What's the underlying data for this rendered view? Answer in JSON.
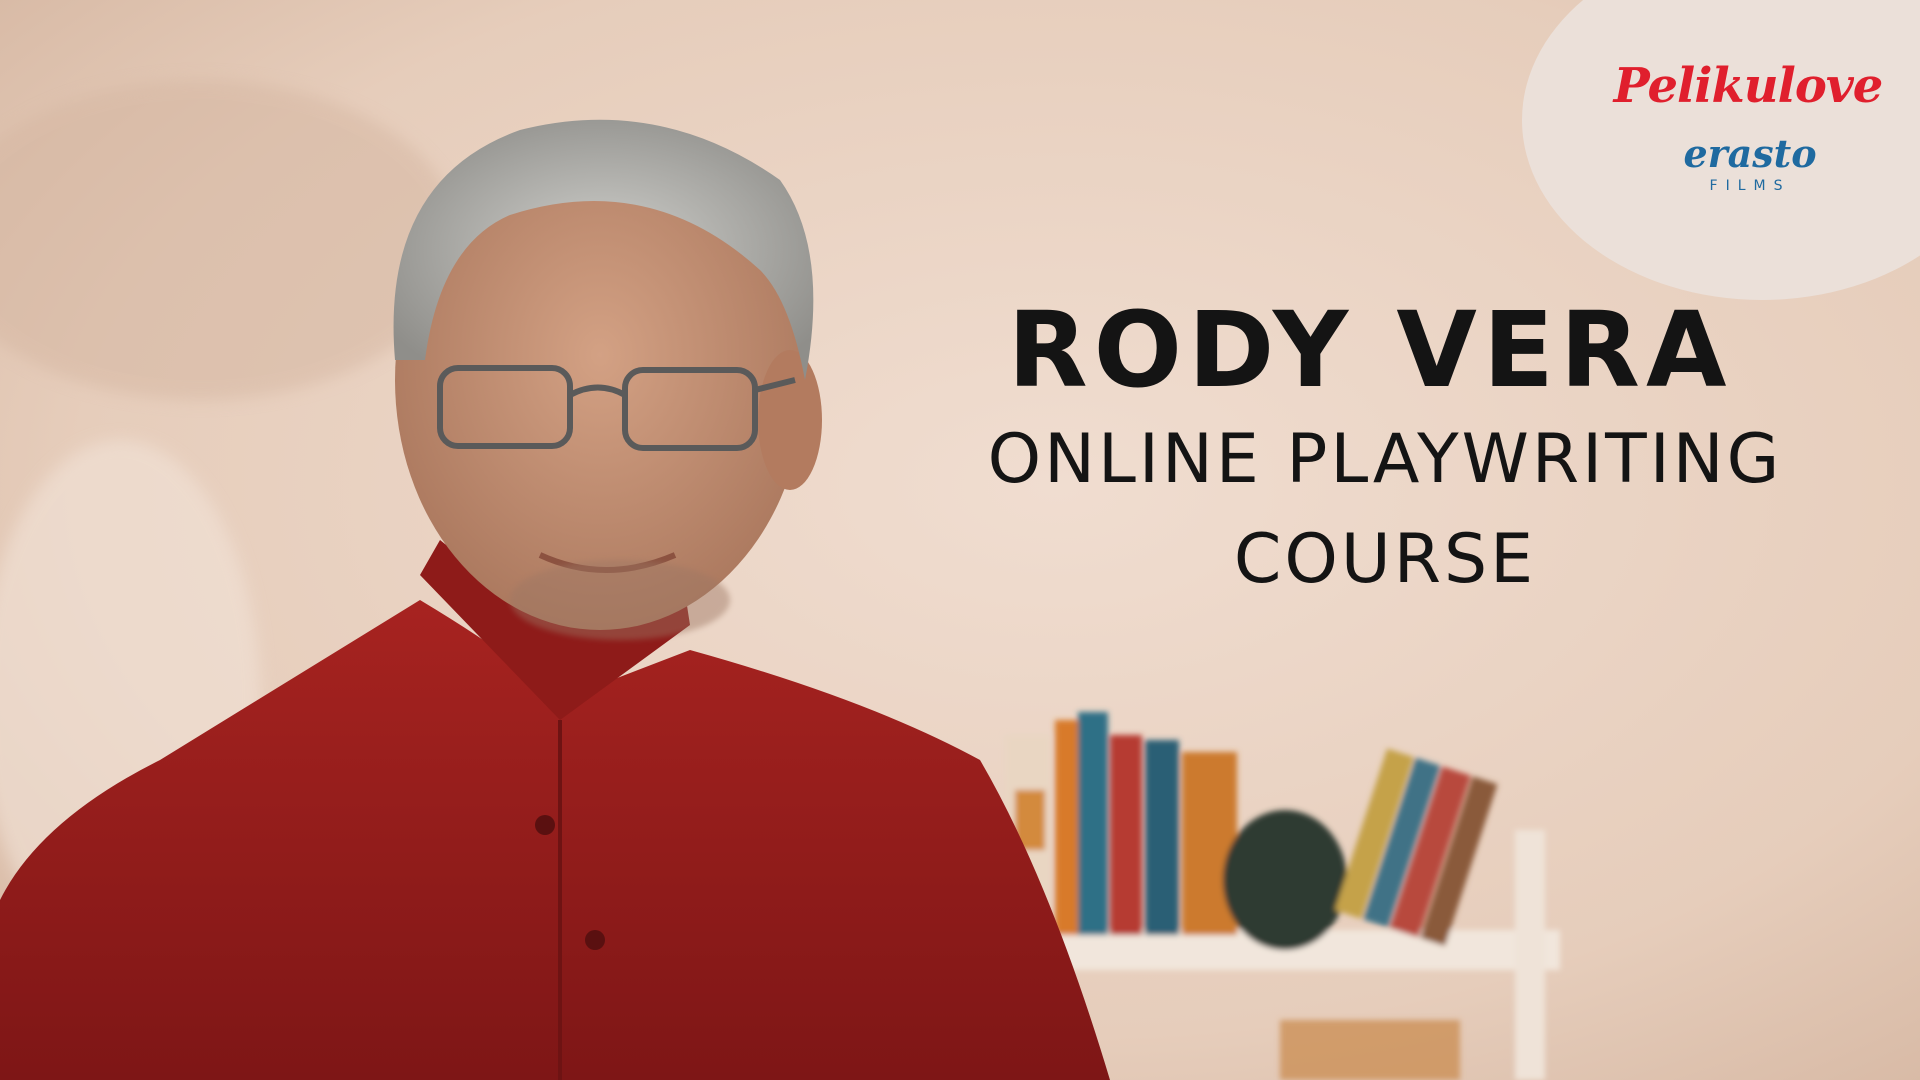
{
  "title": {
    "name": "RODY VERA",
    "line1": "ONLINE PLAYWRITING",
    "line2": "COURSE"
  },
  "logos": {
    "primary": "Pelikulove",
    "secondary": "erasto",
    "secondary_sub": "FILMS"
  },
  "colors": {
    "text": "#141414",
    "primary_logo": "#e01f2d",
    "secondary_logo": "#1f6aa0",
    "badge": "#ebe0d9",
    "shirt": "#9b1f1c",
    "wall": "#e9d2c1"
  }
}
